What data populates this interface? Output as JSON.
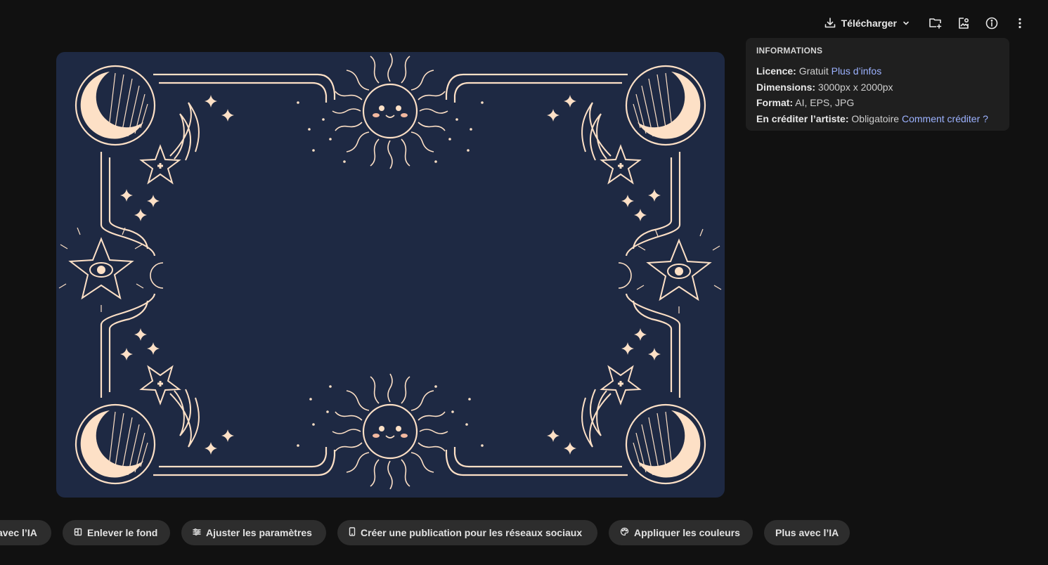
{
  "toolbar": {
    "download_label": "Télécharger",
    "icons": [
      "download-icon",
      "chevron-down-icon",
      "folder-add-icon",
      "image-user-icon",
      "info-icon",
      "more-vertical-icon"
    ]
  },
  "info_panel": {
    "title": "INFORMATIONS",
    "license_label": "Licence:",
    "license_value": "Gratuit",
    "license_link": "Plus d’infos",
    "dimensions_label": "Dimensions:",
    "dimensions_value": "3000px x 2000px",
    "format_label": "Format:",
    "format_value": "AI, EPS, JPG",
    "credit_label": "En créditer l’artiste:",
    "credit_value": "Obligatoire",
    "credit_link": "Comment créditer ?"
  },
  "preview": {
    "background_color": "#1e2943",
    "line_color": "#fde0c6",
    "icons": [
      "crescent-moon-icon",
      "sun-face-icon",
      "shooting-star-icon",
      "eye-star-icon",
      "sparkle-icon"
    ]
  },
  "actions": [
    {
      "label": "avec l’IA",
      "icon": ""
    },
    {
      "label": "Enlever le fond",
      "icon": "remove-background-icon"
    },
    {
      "label": "Ajuster les paramètres",
      "icon": "sliders-icon"
    },
    {
      "label": "Créer une publication pour les réseaux sociaux",
      "icon": "phone-icon"
    },
    {
      "label": "Appliquer les couleurs",
      "icon": "palette-icon"
    },
    {
      "label": "Plus avec l’IA",
      "icon": ""
    }
  ],
  "colors": {
    "page_bg": "#111111",
    "panel_bg": "#1f1f1f",
    "chip_bg": "#2d2d2d",
    "link": "#9cb2ff"
  }
}
